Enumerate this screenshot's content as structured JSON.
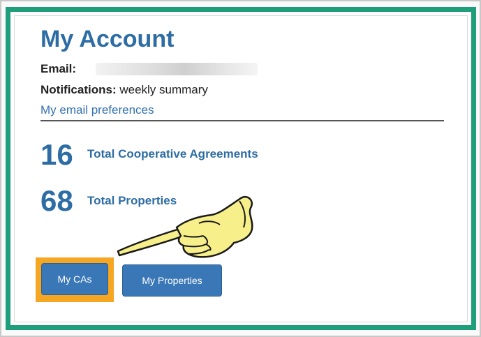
{
  "account": {
    "title": "My Account",
    "email_label": "Email:",
    "notifications_label": "Notifications:",
    "notifications_value": " weekly summary",
    "email_preferences_link": "My email preferences"
  },
  "stats": [
    {
      "value": "16",
      "label": "Total Cooperative Agreements"
    },
    {
      "value": "68",
      "label": "Total Properties"
    }
  ],
  "buttons": {
    "my_cas": "My CAs",
    "my_properties": "My Properties"
  },
  "colors": {
    "accent_blue": "#2e6da4",
    "frame_green": "#1e9e7a",
    "highlight_orange": "#f5a623",
    "hand_yellow": "#f7ef8a"
  }
}
